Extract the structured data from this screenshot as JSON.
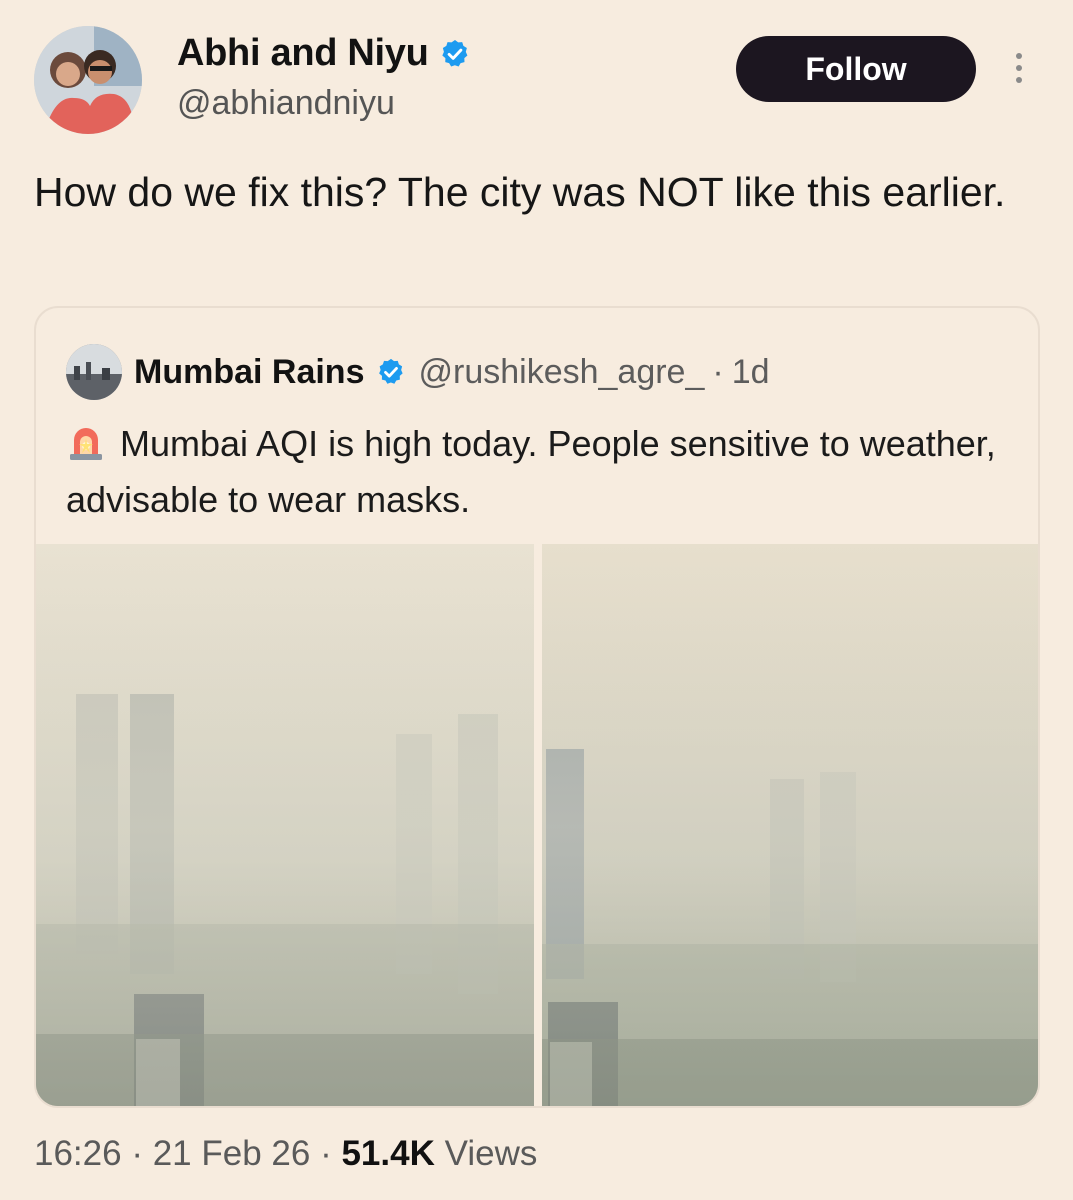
{
  "author": {
    "display_name": "Abhi and Niyu",
    "handle": "@abhiandniyu",
    "verified_icon": "verified-badge-icon"
  },
  "actions": {
    "follow_label": "Follow",
    "more_icon": "more-vertical-icon"
  },
  "tweet": {
    "text": "How do we fix this? The city was NOT like this earlier."
  },
  "quoted_tweet": {
    "display_name": "Mumbai Rains",
    "handle": "@rushikesh_agre_",
    "separator": "·",
    "time": "1d",
    "siren_icon": "siren-emoji-icon",
    "text": "Mumbai AQI is high today. People sensitive to weather, advisable to wear masks.",
    "photos": [
      "smoggy-city-skyline-photo",
      "smoggy-city-skyline-photo"
    ]
  },
  "footer": {
    "time": "16:26",
    "sep1": "·",
    "date": "21 Feb 26",
    "sep2": "·",
    "views_count": "51.4K",
    "views_label": "Views"
  },
  "colors": {
    "background": "#f7ecdf",
    "verified": "#1d9bf0",
    "follow_button": "#1c1620"
  }
}
